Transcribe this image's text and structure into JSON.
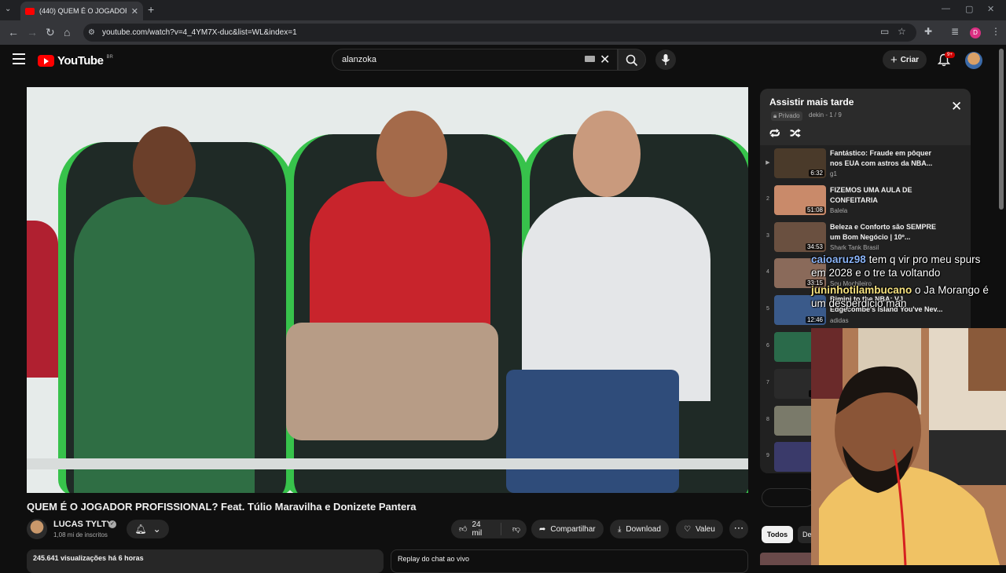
{
  "browser": {
    "tab_title": "(440) QUEM É O JOGADOR PROF",
    "url": "youtube.com/watch?v=4_4YM7X-duc&list=WL&index=1",
    "profile_initial": "D"
  },
  "header": {
    "logo_text": "YouTube",
    "country_code": "BR",
    "search_value": "alanzoka",
    "create_label": "Criar",
    "notif_count": "9+"
  },
  "video": {
    "title": "QUEM É O JOGADOR PROFISSIONAL? Feat. Túlio Maravilha e Donizete Pantera",
    "channel": "LUCAS TYLTY",
    "subscribers": "1,08 mi de inscritos",
    "likes": "24 mil",
    "share_label": "Compartilhar",
    "download_label": "Download",
    "thanks_label": "Valeu",
    "views_time": "245.641 visualizações  há 6 horas",
    "chat_replay": "Replay do chat ao vivo"
  },
  "playlist": {
    "title": "Assistir mais tarde",
    "privacy": "Privado",
    "meta": "dekin - 1 / 9",
    "items": [
      {
        "idx": "▶",
        "title": "Fantástico: Fraude em pôquer nos EUA com astros da NBA...",
        "channel": "g1",
        "duration": "6:32",
        "color": "#4a3a2a"
      },
      {
        "idx": "2",
        "title": "FIZEMOS UMA AULA DE CONFEITARIA",
        "channel": "Balela",
        "duration": "51:08",
        "color": "#c98a6a"
      },
      {
        "idx": "3",
        "title": "Beleza e Conforto são SEMPRE um Bom Negócio | 10º...",
        "channel": "Shark Tank Brasil",
        "duration": "34:53",
        "color": "#6a5040"
      },
      {
        "idx": "4",
        "title": "",
        "channel": "Sou Mochileiro",
        "duration": "33:15",
        "color": "#8a6a5a"
      },
      {
        "idx": "5",
        "title": "",
        "channel": "adidas",
        "duration": "12:46",
        "color": "#3a5a8a"
      },
      {
        "idx": "6",
        "title": "",
        "channel": "",
        "duration": "",
        "color": "#2a6a4a"
      },
      {
        "idx": "7",
        "title": "",
        "channel": "",
        "duration": "1:00",
        "color": "#2a2a2a"
      },
      {
        "idx": "8",
        "title": "",
        "channel": "",
        "duration": "36",
        "color": "#7a7a6a"
      },
      {
        "idx": "9",
        "title": "",
        "channel": "",
        "duration": "",
        "color": "#3a3a6a"
      }
    ]
  },
  "chips": {
    "all": "Todos",
    "partial": "De"
  },
  "overlay_chat": [
    {
      "user": "caioaruz98",
      "message": "tem q vir pro meu spurs",
      "color": "#8ab4f8"
    },
    {
      "user": "",
      "message": "em 2028 e o tre ta voltando",
      "color": "#ffffff"
    },
    {
      "user": "juninhotilambucano",
      "message": "o Ja Morango é",
      "color": "#f6e27f"
    },
    {
      "user": "",
      "message": "um desperdicio man",
      "color": "#ffffff"
    }
  ],
  "overlay_text_behind": {
    "line_a": "Bimini to the NBA: VJ",
    "line_b": "Edgecombe's Island You've Nev..."
  }
}
